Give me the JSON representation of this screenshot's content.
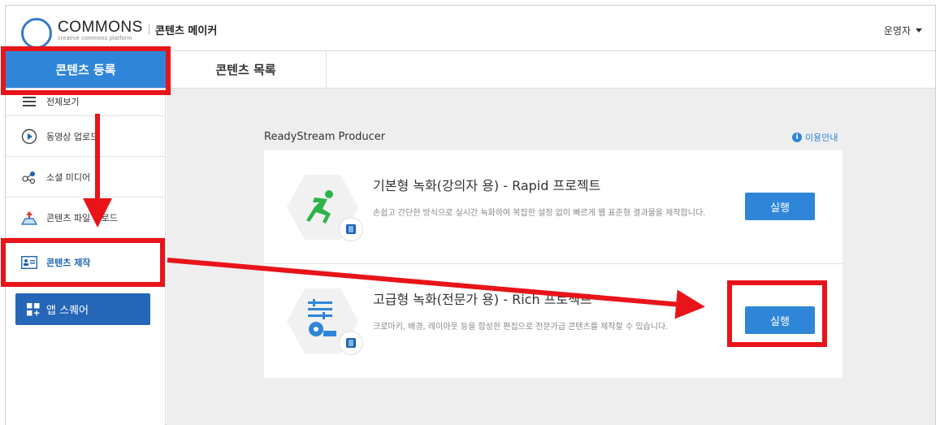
{
  "header": {
    "logo_text": "COMMONS",
    "logo_sub": "creative commons platform",
    "app_title": "콘텐츠 메이커",
    "user_label": "운영자"
  },
  "tabs": [
    {
      "label": "콘텐츠 등록",
      "active": true
    },
    {
      "label": "콘텐츠 목록",
      "active": false
    }
  ],
  "sidebar": {
    "items": [
      {
        "label": "전체보기",
        "icon": "menu-icon"
      },
      {
        "label": "동영상 업로드",
        "icon": "play-circle-icon"
      },
      {
        "label": "소셜 미디어",
        "icon": "share-icon"
      },
      {
        "label": "콘텐츠 파일 업로드",
        "icon": "upload-icon"
      },
      {
        "label": "콘텐츠 제작",
        "icon": "content-create-icon",
        "active": true
      }
    ],
    "app_square": {
      "label": "앱 스퀘어",
      "icon": "app-grid-icon"
    }
  },
  "main": {
    "producer_title": "ReadyStream Producer",
    "help_label": "이용안내",
    "cards": [
      {
        "title": "기본형 녹화(강의자 용) - Rapid 프로젝트",
        "desc": "손쉽고 간단한 방식으로 실시간 녹화하여 복잡한 설정 없이 빠르게 웹 표준형 결과물을 제작합니다.",
        "button": "실행",
        "icon": "runner-icon"
      },
      {
        "title": "고급형 녹화(전문가 용) - Rich 프로젝트",
        "desc": "크로마키, 배경, 레이아웃 등을 합성한 편집으로 전문가급 콘텐츠를 제작할 수 있습니다.",
        "button": "실행",
        "icon": "editor-icon"
      }
    ]
  },
  "colors": {
    "accent": "#2f86d8",
    "app_square_bg": "#2566b8",
    "annotation": "#e8141a"
  }
}
